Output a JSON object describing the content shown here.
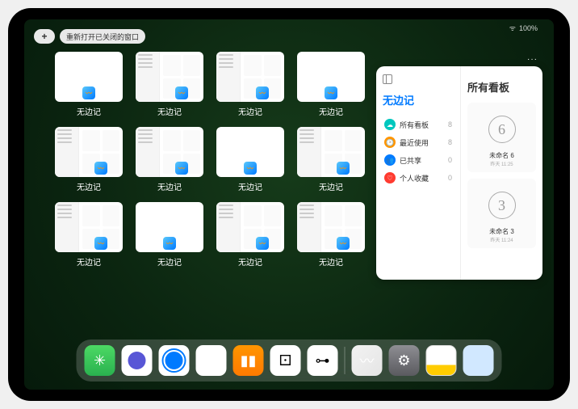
{
  "statusbar": {
    "wifi": "ᯤ",
    "battery": "100%",
    "icon": "▮"
  },
  "topbar": {
    "add_label": "+",
    "reopen_label": "重新打开已关闭的窗口"
  },
  "thumbs": {
    "label": "无边记",
    "items": [
      {
        "type": "blank"
      },
      {
        "type": "grid"
      },
      {
        "type": "grid"
      },
      {
        "type": "blank"
      },
      {
        "type": "grid"
      },
      {
        "type": "grid"
      },
      {
        "type": "blank"
      },
      {
        "type": "grid"
      },
      {
        "type": "grid"
      },
      {
        "type": "blank"
      },
      {
        "type": "grid"
      },
      {
        "type": "grid"
      }
    ]
  },
  "stage": {
    "more": "···",
    "left_title": "无边记",
    "nav": [
      {
        "icon": "☁",
        "color": "#00c7be",
        "label": "所有看板",
        "count": "8"
      },
      {
        "icon": "🕑",
        "color": "#ff9500",
        "label": "最近使用",
        "count": "8"
      },
      {
        "icon": "👥",
        "color": "#007aff",
        "label": "已共享",
        "count": "0"
      },
      {
        "icon": "♡",
        "color": "#ff3b30",
        "label": "个人收藏",
        "count": "0"
      }
    ],
    "right_title": "所有看板",
    "boards": [
      {
        "sketch": "6",
        "name": "未命名 6",
        "sub": "昨天 11:25"
      },
      {
        "sketch": "3",
        "name": "未命名 3",
        "sub": "昨天 11:24"
      }
    ]
  },
  "dock": {
    "items": [
      {
        "name": "wechat-icon",
        "class": "di-wechat",
        "glyph": "✳"
      },
      {
        "name": "quark-hd-icon",
        "class": "di-white di-circle-purple",
        "glyph": ""
      },
      {
        "name": "quark-icon",
        "class": "di-white di-circle-blue",
        "glyph": ""
      },
      {
        "name": "play-icon",
        "class": "di-play",
        "glyph": "▶"
      },
      {
        "name": "books-icon",
        "class": "di-books",
        "glyph": "▮▮"
      },
      {
        "name": "dice-icon",
        "class": "di-dice",
        "glyph": "⚀"
      },
      {
        "name": "graph-icon",
        "class": "di-nodes",
        "glyph": "⊶"
      }
    ],
    "items2": [
      {
        "name": "freeform-icon",
        "class": "di-freeform",
        "glyph": "〰"
      },
      {
        "name": "settings-icon",
        "class": "di-settings",
        "glyph": "⚙"
      },
      {
        "name": "notes-icon",
        "class": "di-notes",
        "glyph": ""
      },
      {
        "name": "app-library-icon",
        "class": "di-folder",
        "glyph": ""
      }
    ]
  }
}
